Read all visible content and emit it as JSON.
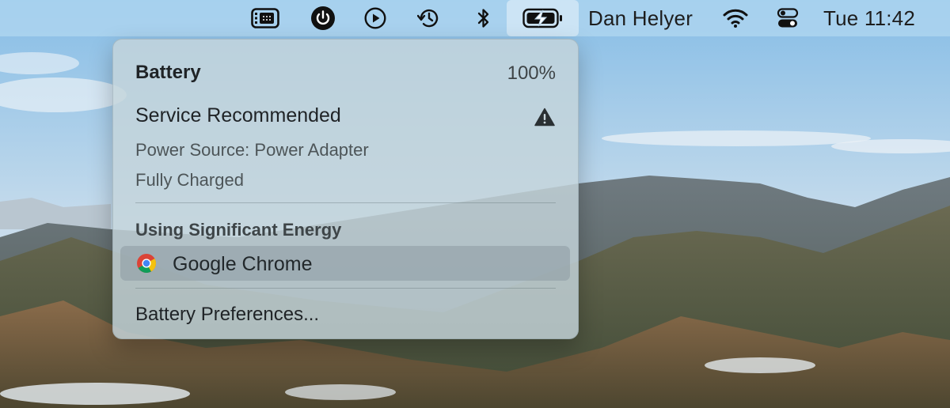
{
  "menubar": {
    "user_name": "Dan Helyer",
    "clock": "Tue 11:42",
    "icons": [
      "stage-manager-icon",
      "power-icon",
      "play-icon",
      "time-machine-icon",
      "bluetooth-icon",
      "battery-charging-icon",
      "wifi-icon",
      "control-center-icon"
    ]
  },
  "battery_menu": {
    "title": "Battery",
    "percent": "100%",
    "condition": "Service Recommended",
    "condition_icon": "warning-icon",
    "power_source": "Power Source: Power Adapter",
    "charge_state": "Fully Charged",
    "energy_heading": "Using Significant Energy",
    "apps": [
      {
        "name": "Google Chrome",
        "icon": "chrome-icon"
      }
    ],
    "preferences_label": "Battery Preferences..."
  }
}
